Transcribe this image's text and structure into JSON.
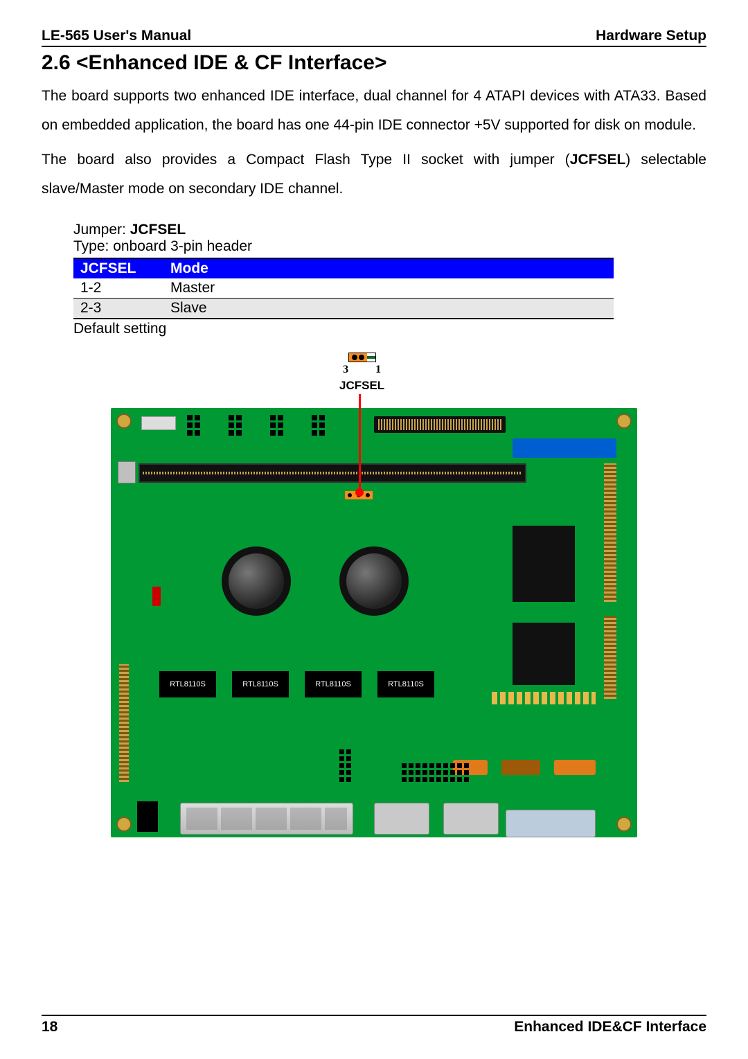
{
  "header": {
    "left": "LE-565 User's Manual",
    "right": "Hardware Setup"
  },
  "section": {
    "title": "2.6 <Enhanced IDE & CF Interface>"
  },
  "paragraphs": {
    "p1": "The board supports two enhanced IDE interface, dual channel for 4 ATAPI devices with ATA33. Based on embedded application, the board has one 44-pin IDE connector +5V supported for disk on module.",
    "p2a": "The board also provides a Compact Flash Type II socket with jumper (",
    "p2b": "JCFSEL",
    "p2c": ") selectable slave/Master mode on secondary IDE channel."
  },
  "jumper": {
    "label": "Jumper: ",
    "name": "JCFSEL",
    "type_line": "Type: onboard 3-pin header",
    "columns": {
      "c1": "JCFSEL",
      "c2": "Mode"
    },
    "rows": [
      {
        "c1": "1-2",
        "c2": "Master"
      },
      {
        "c1": "2-3",
        "c2": "Slave"
      }
    ],
    "default_note": "Default setting"
  },
  "diagram": {
    "pin_left": "3",
    "pin_right": "1",
    "callout_label": "JCFSEL",
    "chip_label": "RTL8110S"
  },
  "footer": {
    "page": "18",
    "title": "Enhanced IDE&CF Interface"
  }
}
